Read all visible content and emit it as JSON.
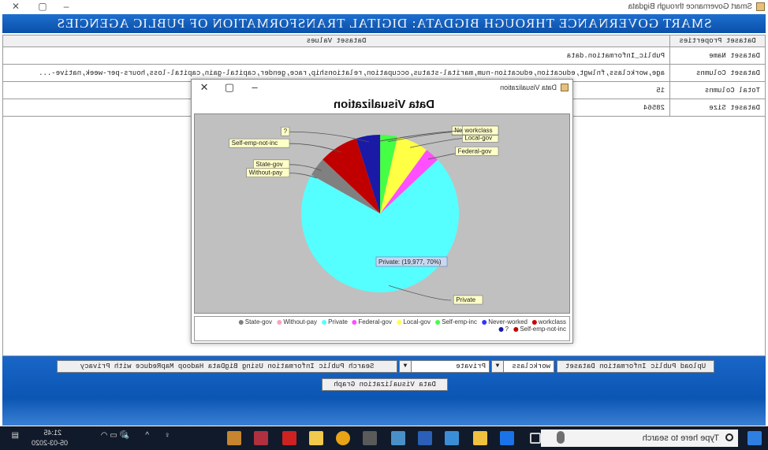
{
  "window": {
    "title": "Smart Governance through Bigdata"
  },
  "header": {
    "title": "SMART GOVERNANCE THROUGH BIGDATA: DIGITAL TRANSFORMATION OF PUBLIC AGENCIES"
  },
  "table": {
    "headers": [
      "Dataset Properties",
      "Dataset Values"
    ],
    "rows": [
      [
        "Dataset Name",
        "Public_Information.data"
      ],
      [
        "Dataset Columns",
        "age,workclass,fnlwgt,education,education-num,marital-status,occupation,relationship,race,gender,capital-gain,capital-loss,hours-per-week,native-..."
      ],
      [
        "Total Columns",
        "15"
      ],
      [
        "Dataset Size",
        "28564"
      ]
    ]
  },
  "controls": {
    "upload_label": "Upload Public Information Dataset",
    "column_select": "workclass",
    "value_select": "Private",
    "search_label": "Search Public Information Using BigData Hadoop MapReduce with Privacy",
    "graph_label": "Data Visualization Graph"
  },
  "dialog": {
    "title": "Data Visualization",
    "tooltip": "Private: (19,977, 70%)"
  },
  "taskbar": {
    "search_placeholder": "Type here to search",
    "time": "21:45",
    "date": "05-03-2020"
  },
  "chart_data": {
    "type": "pie",
    "title": "Data Visualization",
    "slices": [
      {
        "label": "?",
        "value": 1400,
        "color": "#1a1aa6"
      },
      {
        "label": "Self-emp-not-inc",
        "value": 2300,
        "color": "#c00000"
      },
      {
        "label": "State-gov",
        "value": 1100,
        "color": "#808080"
      },
      {
        "label": "Without-pay",
        "value": 10,
        "color": "#ff9fbf"
      },
      {
        "label": "Private",
        "value": 19977,
        "color": "#55ffff"
      },
      {
        "label": "Federal-gov",
        "value": 850,
        "color": "#ff4fff"
      },
      {
        "label": "Local-gov",
        "value": 1850,
        "color": "#ffff44"
      },
      {
        "label": "Self-emp-inc",
        "value": 1000,
        "color": "#44ff44"
      },
      {
        "label": "Never-worked",
        "value": 5,
        "color": "#3333ff"
      },
      {
        "label": "workclass",
        "value": 2,
        "color": "#cc0000"
      }
    ],
    "legend_order": [
      "workclass",
      "Never-worked",
      "Self-emp-inc",
      "Local-gov",
      "Federal-gov",
      "Private",
      "Without-pay",
      "State-gov",
      "Self-emp-not-inc",
      "?"
    ],
    "legend_colors": {
      "workclass": "#cc0000",
      "Never-worked": "#3333ff",
      "Self-emp-inc": "#44ff44",
      "Local-gov": "#ffff44",
      "Federal-gov": "#ff4fff",
      "Private": "#55ffff",
      "Without-pay": "#ff9fbf",
      "State-gov": "#808080",
      "Self-emp-not-inc": "#c00000",
      "?": "#1a1aa6"
    }
  }
}
